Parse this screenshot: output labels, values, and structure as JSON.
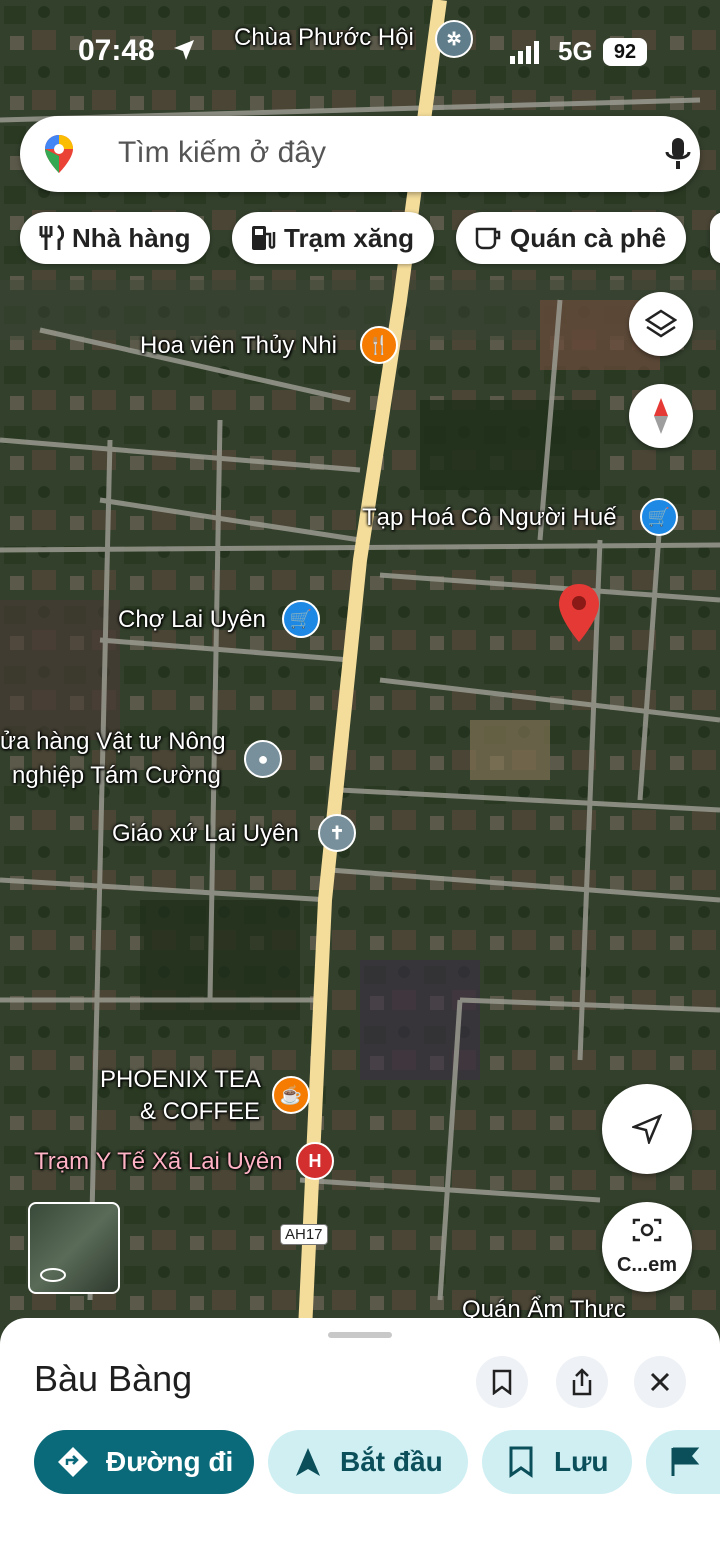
{
  "status_bar": {
    "time": "07:48",
    "network": "5G",
    "battery": "92"
  },
  "search": {
    "placeholder": "Tìm kiếm ở đây"
  },
  "chips": [
    {
      "label": "Nhà hàng",
      "icon": "fork-knife-icon"
    },
    {
      "label": "Trạm xăng",
      "icon": "gas-station-icon"
    },
    {
      "label": "Quán cà phê",
      "icon": "coffee-cup-icon"
    }
  ],
  "map": {
    "labels": {
      "chua_phuoc_hoi": "Chùa Phước Hội",
      "hoa_vien": "Hoa viên Thủy Nhi",
      "tap_hoa": "Tạp Hoá Cô Người Huế",
      "cho": "Chợ Lai Uyên",
      "vat_tu_1": "ửa hàng Vật tư Nông",
      "vat_tu_2": "nghiệp Tám Cường",
      "giao_xu": "Giáo xứ Lai Uyên",
      "phoenix_1": "PHOENIX TEA",
      "phoenix_2": "& COFFEE",
      "tram_y_te": "Trạm Y Tế Xã Lai Uyên",
      "quan_am_thuc": "Quán Ẩm Thực",
      "highway": "AH17"
    },
    "camera_button_label": "C...em",
    "colors": {
      "pin": "#e53935",
      "food": "#f57c00",
      "shop": "#1e88e5",
      "poi": "#78909c",
      "health": "#d32f2f",
      "road": "#f4dc9a"
    }
  },
  "sheet": {
    "title": "Bàu Bàng",
    "actions": {
      "directions": "Đường đi",
      "start": "Bắt đầu",
      "save": "Lưu"
    },
    "accent": "#0b6a7a"
  }
}
